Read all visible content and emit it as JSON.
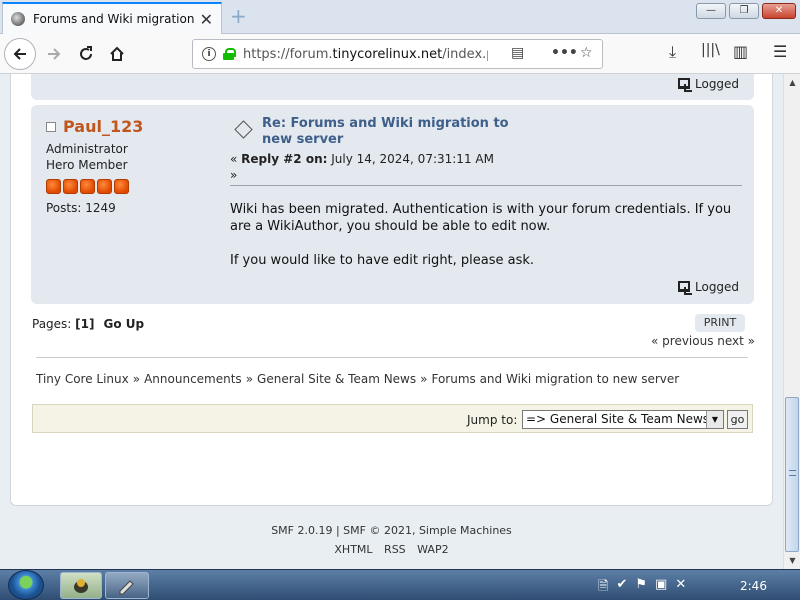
{
  "browser": {
    "tab_title": "Forums and Wiki migration to",
    "tab_close": "✕",
    "new_tab": "+",
    "url_prefix": "https://forum.",
    "url_host": "tinycorelinux.net",
    "url_path": "/index.p",
    "window_controls": [
      "—",
      "❐",
      "✕"
    ]
  },
  "prev_post": {
    "logged": "Logged"
  },
  "post": {
    "username": "Paul_123",
    "role": "Administrator",
    "group": "Hero Member",
    "stars": 5,
    "posts": "Posts: 1249",
    "title": "Re: Forums and Wiki migration to new server",
    "meta_prefix": "« ",
    "meta_reply": "Reply #2 on:",
    "meta_date": " July 14, 2024, 07:31:11 AM",
    "meta_suffix": "»",
    "body": [
      "Wiki has been migrated.  Authentication is with your forum credentials. If you are a WikiAuthor, you should be able to edit now.",
      "If you would like to have edit right, please ask."
    ],
    "logged": "Logged"
  },
  "pagination": {
    "pages_label": "Pages: ",
    "current": "[1]",
    "go_up": "Go Up",
    "print": "PRINT",
    "prev_next": "« previous next »"
  },
  "breadcrumb": {
    "items": [
      "Tiny Core Linux",
      "Announcements",
      "General Site & Team News",
      "Forums and Wiki migration to new server"
    ],
    "separator": "»"
  },
  "jump": {
    "label": "Jump to:",
    "selected": "=> General Site & Team News",
    "go": "go"
  },
  "footer": {
    "credit": "SMF 2.0.19 | SMF © 2021, Simple Machines",
    "links": [
      "XHTML",
      "RSS",
      "WAP2"
    ]
  },
  "taskbar": {
    "clock": "2:46"
  }
}
